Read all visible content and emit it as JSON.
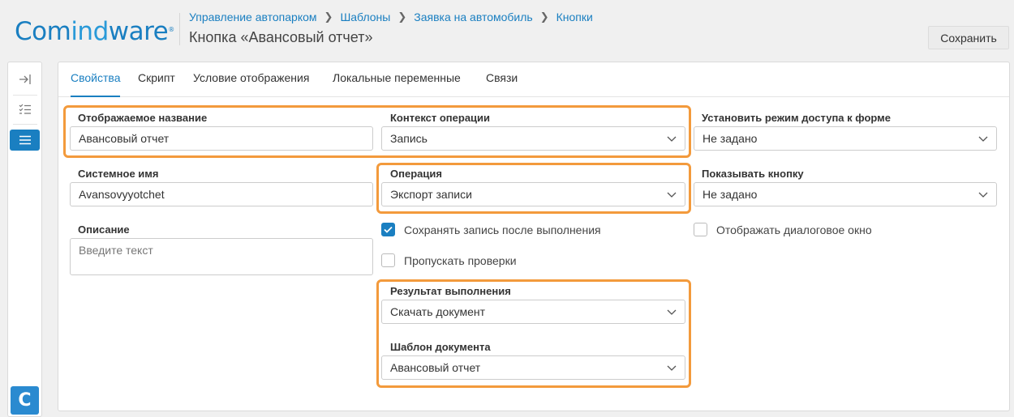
{
  "app": {
    "logo_parts": [
      "Com",
      "ind",
      "ware"
    ],
    "logo_reg": "®"
  },
  "breadcrumb": [
    "Управление автопарком",
    "Шаблоны",
    "Заявка на автомобиль",
    "Кнопки"
  ],
  "page_title": "Кнопка «Авансовый отчет»",
  "save_label": "Сохранить",
  "rail": {
    "logo_letter": "C"
  },
  "tabs": [
    {
      "label": "Свойства",
      "active": true
    },
    {
      "label": "Скрипт"
    },
    {
      "label": "Условие отображения"
    },
    {
      "label": "Локальные переменные"
    },
    {
      "label": "Связи"
    }
  ],
  "fields": {
    "display_name": {
      "label": "Отображаемое название",
      "value": "Авансовый отчет"
    },
    "op_context": {
      "label": "Контекст операции",
      "value": "Запись"
    },
    "access_mode": {
      "label": "Установить режим доступа к форме",
      "value": "Не задано"
    },
    "system_name": {
      "label": "Системное имя",
      "value": "Avansovyyotchet"
    },
    "operation": {
      "label": "Операция",
      "value": "Экспорт записи"
    },
    "show_button": {
      "label": "Показывать кнопку",
      "value": "Не задано"
    },
    "description": {
      "label": "Описание",
      "placeholder": "Введите текст"
    },
    "result": {
      "label": "Результат выполнения",
      "value": "Скачать документ"
    },
    "doc_template": {
      "label": "Шаблон документа",
      "value": "Авансовый отчет"
    }
  },
  "checkboxes": {
    "save_after": {
      "label": "Сохранять запись после выполнения",
      "checked": true
    },
    "skip_checks": {
      "label": "Пропускать проверки",
      "checked": false
    },
    "show_dialog": {
      "label": "Отображать диалоговое окно",
      "checked": false
    }
  },
  "colors": {
    "accent": "#1a7fc1",
    "highlight": "#f39a3c"
  }
}
